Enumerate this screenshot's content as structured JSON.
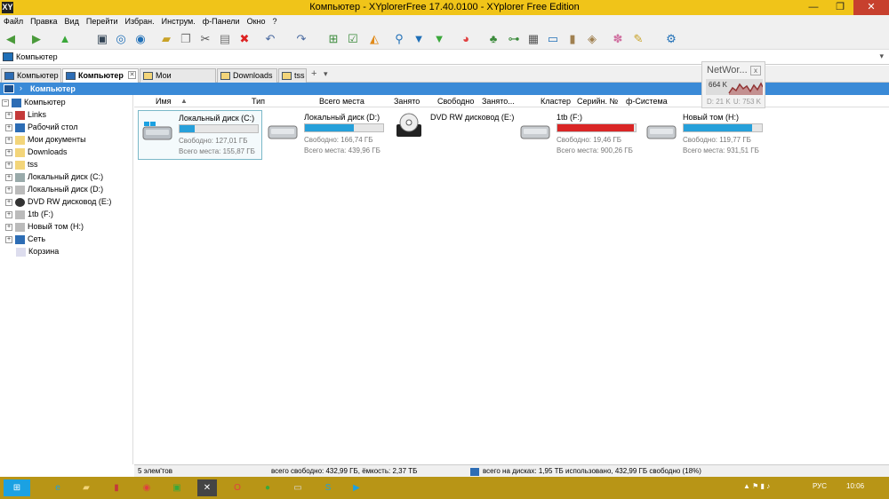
{
  "window": {
    "title": "Компьютер - XYplorerFree 17.40.0100 - XYplorer Free Edition",
    "app_icon": "XY",
    "minimize": "—",
    "maximize": "❐",
    "close": "✕"
  },
  "menu": [
    "Файл",
    "Правка",
    "Вид",
    "Перейти",
    "Избран.",
    "Инструм.",
    "ф-Панели",
    "Окно",
    "?"
  ],
  "toolbar_icons": [
    "back-icon",
    "forward-icon",
    "up-icon",
    "computer-icon",
    "target-icon",
    "search-circle-icon",
    "new-folder-icon",
    "copy-icon",
    "cut-icon",
    "paste-icon",
    "delete-icon",
    "undo-icon",
    "redo-icon",
    "tree-icon",
    "checkbox-icon",
    "pizza-icon",
    "find-icon",
    "filter-icon",
    "filter-green-icon",
    "pie-icon",
    "tree-green-icon",
    "network-icon",
    "grid-icon",
    "panes-icon",
    "bookmark-icon",
    "tag-icon",
    "puzzle-icon",
    "brush-icon",
    "gear-icon"
  ],
  "address": {
    "value": "Компьютер",
    "dropdown": "▾"
  },
  "tabs": [
    {
      "label": "Компьютер"
    },
    {
      "label": "Компьютер",
      "close": "✕"
    },
    {
      "label": "Мои документы"
    },
    {
      "label": "Downloads"
    },
    {
      "label": "tss"
    }
  ],
  "tab_add": "+",
  "tab_more": "▾",
  "breadcrumb": {
    "arrow": "›",
    "label": "Компьютер"
  },
  "tree": [
    {
      "label": "Компьютер",
      "expander": "−",
      "icon": "computer-icon"
    },
    {
      "label": "Links",
      "expander": "+",
      "icon": "links-icon"
    },
    {
      "label": "Рабочий стол",
      "expander": "+",
      "icon": "desktop-icon"
    },
    {
      "label": "Мои документы",
      "expander": "+",
      "icon": "documents-icon"
    },
    {
      "label": "Downloads",
      "expander": "+",
      "icon": "downloads-icon"
    },
    {
      "label": "tss",
      "expander": "+",
      "icon": "folder-icon"
    },
    {
      "label": "Локальный диск (C:)",
      "expander": "+",
      "icon": "drive-icon"
    },
    {
      "label": "Локальный диск (D:)",
      "expander": "+",
      "icon": "drive-icon"
    },
    {
      "label": "DVD RW дисковод (E:)",
      "expander": "+",
      "icon": "dvd-icon"
    },
    {
      "label": "1tb (F:)",
      "expander": "+",
      "icon": "drive-icon"
    },
    {
      "label": "Новый том (H:)",
      "expander": "+",
      "icon": "drive-icon"
    },
    {
      "label": "Сеть",
      "expander": "+",
      "icon": "network-icon"
    },
    {
      "label": "Корзина",
      "expander": "",
      "icon": "recycle-bin-icon"
    }
  ],
  "columns": [
    "Имя",
    "▲",
    "Тип",
    "Всего места",
    "Занято",
    "Свободно",
    "Занято...",
    "Кластер",
    "Серийн. №",
    "ф-Система"
  ],
  "drives": [
    {
      "name": "Локальный диск (C:)",
      "free": "Свободно: 127,01 ГБ",
      "total": "Всего места: 155,87 ГБ",
      "fill_fraction": 0.19,
      "color": "#26a0da",
      "icon": "windows-drive-icon"
    },
    {
      "name": "Локальный диск (D:)",
      "free": "Свободно: 166,74 ГБ",
      "total": "Всего места: 439,96 ГБ",
      "fill_fraction": 0.62,
      "color": "#26a0da",
      "icon": "drive-icon"
    },
    {
      "name": "DVD RW дисковод (E:)",
      "free": "",
      "total": "",
      "fill_fraction": null,
      "color": "",
      "icon": "dvd-icon"
    },
    {
      "name": "1tb (F:)",
      "free": "Свободно: 19,46 ГБ",
      "total": "Всего места: 900,26 ГБ",
      "fill_fraction": 0.98,
      "color": "#da2626",
      "icon": "drive-icon"
    },
    {
      "name": "Новый том (H:)",
      "free": "Свободно: 119,77 ГБ",
      "total": "Всего места: 931,51 ГБ",
      "fill_fraction": 0.87,
      "color": "#26a0da",
      "icon": "drive-icon"
    }
  ],
  "status": {
    "count": "5 элем'тов",
    "free_cap": "всего свободно: 432,99 ГБ, ёмкость: 2,37 ТБ",
    "disks": "всего на дисках: 1,95 ТБ использовано,   432,99 ГБ свободно (18%)"
  },
  "network_widget": {
    "title": "NetWor...",
    "close": "x",
    "rate1": "664 K",
    "rate2": "D: 21 K",
    "rate3": "U: 753 K"
  },
  "taskbar": {
    "lang": "РУС",
    "time": "10:06"
  }
}
